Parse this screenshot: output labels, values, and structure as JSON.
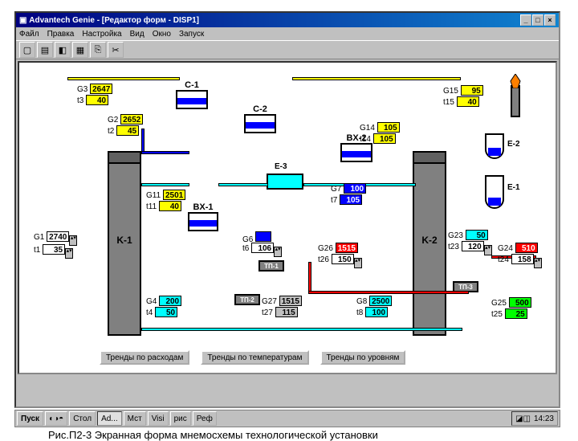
{
  "window": {
    "title": "Advantech Genie - [Редактор форм - DISP1]",
    "btn_min": "_",
    "btn_max": "□",
    "btn_close": "×"
  },
  "menu": [
    "Файл",
    "Правка",
    "Настройка",
    "Вид",
    "Окно",
    "Запуск"
  ],
  "units": {
    "C1": "C-1",
    "C2": "C-2",
    "BX1": "BX-1",
    "BX2": "BX-2",
    "K1": "K-1",
    "K2": "K-2",
    "E1": "E-1",
    "E2": "E-2",
    "E3": "E-3",
    "TP1": "ТП-1",
    "TP2": "ТП-2",
    "TP3": "ТП-3"
  },
  "tags": {
    "G3": {
      "l": "G3",
      "v": "2647"
    },
    "t3": {
      "l": "t3",
      "v": "40"
    },
    "G2": {
      "l": "G2",
      "v": "2652"
    },
    "t2": {
      "l": "t2",
      "v": "45"
    },
    "G11": {
      "l": "G11",
      "v": "2501"
    },
    "t11": {
      "l": "t11",
      "v": "40"
    },
    "G1": {
      "l": "G1",
      "v": "2740"
    },
    "t1": {
      "l": "t1",
      "v": "35"
    },
    "G4": {
      "l": "G4",
      "v": "200"
    },
    "t4": {
      "l": "t4",
      "v": "50"
    },
    "G6": {
      "l": "G6",
      "v": ""
    },
    "t6": {
      "l": "t6",
      "v": "106"
    },
    "G27": {
      "l": "G27",
      "v": "1515"
    },
    "t27": {
      "l": "t27",
      "v": "115"
    },
    "G26": {
      "l": "G26",
      "v": "1515"
    },
    "t26": {
      "l": "t26",
      "v": "150"
    },
    "G7": {
      "l": "G7",
      "v": "100"
    },
    "t7": {
      "l": "t7",
      "v": "105"
    },
    "G8": {
      "l": "G8",
      "v": "2500"
    },
    "t8": {
      "l": "t8",
      "v": "100"
    },
    "G14": {
      "l": "G14",
      "v": "105"
    },
    "t14": {
      "l": "t14",
      "v": "105"
    },
    "G15": {
      "l": "G15",
      "v": "95"
    },
    "t15": {
      "l": "t15",
      "v": "40"
    },
    "G23": {
      "l": "G23",
      "v": "50"
    },
    "t23": {
      "l": "t23",
      "v": "120"
    },
    "G24": {
      "l": "G24",
      "v": "510"
    },
    "t24": {
      "l": "t24",
      "v": "158"
    },
    "G25": {
      "l": "G25",
      "v": "500"
    },
    "t25": {
      "l": "t25",
      "v": "25"
    }
  },
  "buttons": {
    "b1": "Тренды по расходам",
    "b2": "Тренды по температурам",
    "b3": "Тренды по уровням"
  },
  "taskbar": {
    "start": "Пуск",
    "items": [
      "Стол",
      "Ad...",
      "Мст",
      "Visi",
      "рис",
      "Реф"
    ],
    "time": "14:23"
  },
  "caption": "Рис.П2-3 Экранная форма мнемосхемы технологической установки"
}
